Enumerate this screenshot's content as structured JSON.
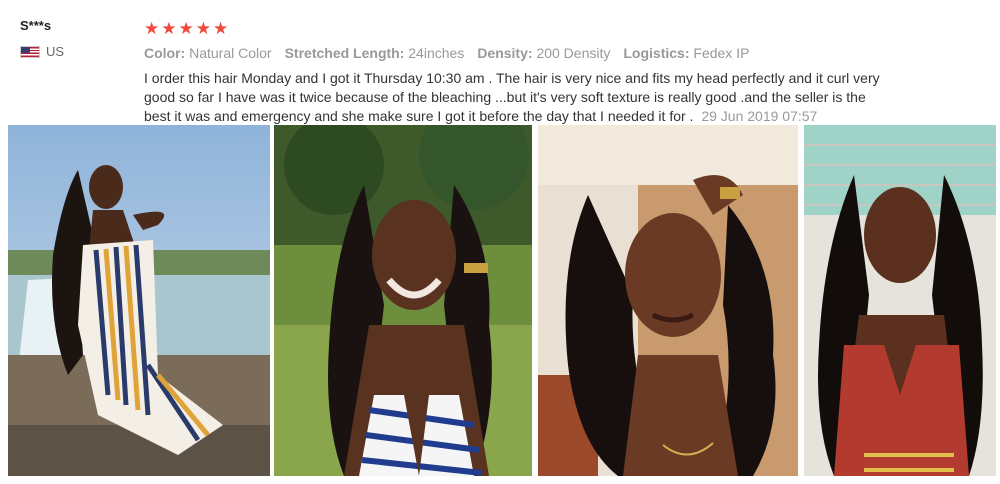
{
  "reviewer": {
    "name": "S***s",
    "country": "US",
    "flag_icon": "us-flag-icon"
  },
  "review": {
    "rating": 5,
    "star_color": "#f04a3e",
    "attributes": [
      {
        "key": "Color:",
        "value": "Natural Color"
      },
      {
        "key": "Stretched Length:",
        "value": "24inches"
      },
      {
        "key": "Density:",
        "value": "200 Density"
      },
      {
        "key": "Logistics:",
        "value": "Fedex IP"
      }
    ],
    "text": "I order this hair Monday and I got it Thursday 10:30 am . The hair is very nice and fits my head perfectly and it curl very good so far I have was it twice because of the bleaching ...but it's very soft texture is really good .and the seller is the best it was and emergency and she make sure I got it before the day that I needed it for .",
    "date": "29 Jun 2019 07:57"
  },
  "photos": [
    {
      "subject": "woman in striped dress seated by waterfall"
    },
    {
      "subject": "woman with wavy hair in striped top outdoors"
    },
    {
      "subject": "woman with long wavy hair indoors"
    },
    {
      "subject": "woman with straight hair in red top"
    }
  ]
}
